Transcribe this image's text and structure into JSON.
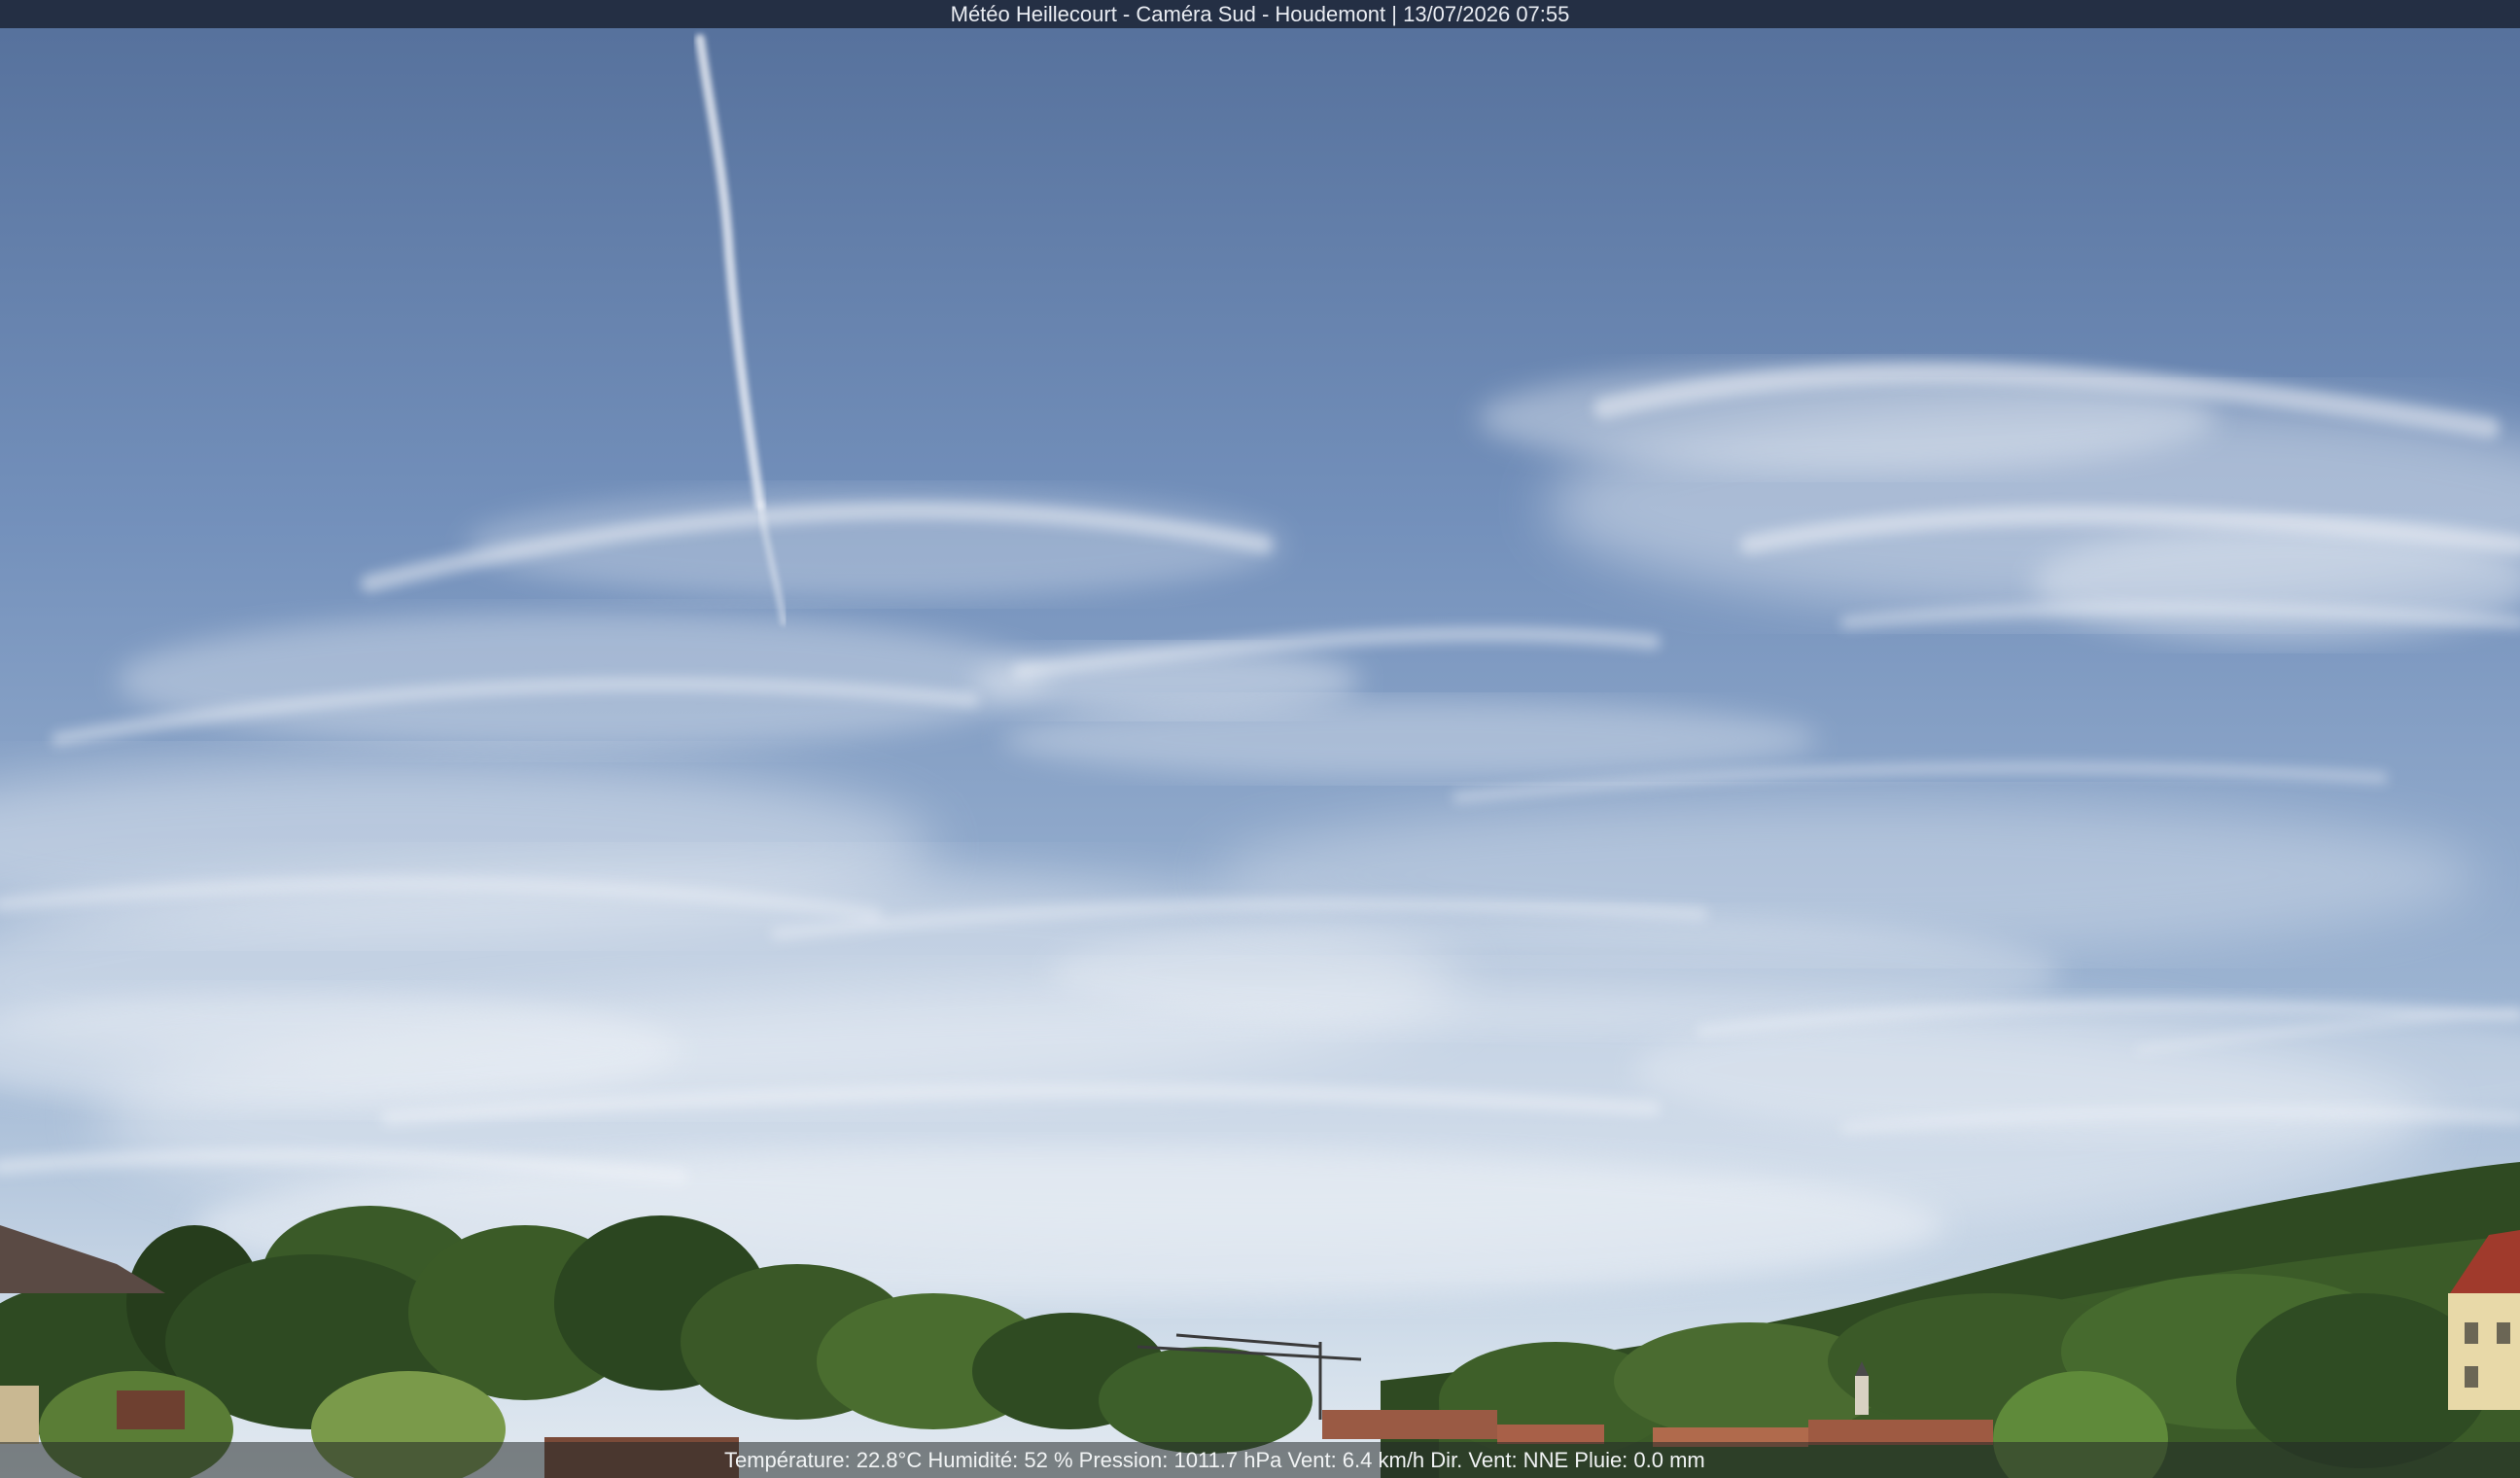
{
  "overlay": {
    "title": "Météo Heillecourt - Caméra Sud - Houdemont | 13/07/2026 07:55",
    "weather": {
      "temperature": "Température: 22.8°C",
      "humidity": "Humidité: 52 %",
      "pressure": "Pression: 1011.7 hPa",
      "wind_speed": "Vent: 6.4 km/h",
      "wind_direction": "Dir. Vent: NNE",
      "rain": "Pluie: 0.0 mm"
    }
  },
  "colors": {
    "sky_top": "#55709b",
    "sky_mid": "#7e98c2",
    "sky_horizon": "#c9d8e8",
    "cloud": "#eef2f7",
    "tree_dark": "#1f3218",
    "tree_mid": "#3b5a27",
    "tree_light": "#6a8a3c",
    "roof": "#9a5a44",
    "wall": "#e8d9a8"
  }
}
